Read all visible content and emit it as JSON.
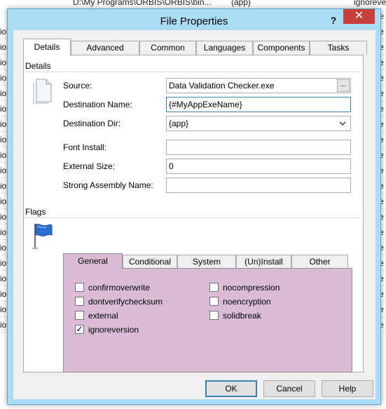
{
  "background": {
    "top_path": "D:\\My Programs\\ORBIS\\ORBIS\\bin...",
    "top_app": "{app}",
    "top_flag": "ignorevers",
    "left_fragments": [
      "io",
      "io",
      "io",
      "io",
      "io",
      "io",
      "io",
      "io",
      "io",
      "io",
      "io",
      "io",
      "io",
      "io",
      "io",
      "io",
      "io",
      "io",
      "io",
      "io"
    ],
    "right_fragments": [
      "ve",
      "ve",
      "ve",
      "ve",
      "ve",
      "ve",
      "ve",
      "ve",
      "ve",
      "ve",
      "ve",
      "ve",
      "ve",
      "ve",
      "ve",
      "ve",
      "ve",
      "ve",
      "ve",
      "ve",
      "ve"
    ]
  },
  "dialog": {
    "title": "File Properties",
    "help_glyph": "?",
    "close_glyph": "✕",
    "tabs": [
      {
        "label": "Details",
        "active": true
      },
      {
        "label": "Advanced",
        "active": false
      },
      {
        "label": "Common",
        "active": false
      },
      {
        "label": "Languages",
        "active": false
      },
      {
        "label": "Components",
        "active": false
      },
      {
        "label": "Tasks",
        "active": false
      }
    ],
    "details": {
      "section_label": "Details",
      "icon": "document-icon",
      "source_label": "Source:",
      "source_value": "Data Validation Checker.exe",
      "browse_label": "...",
      "dest_name_label": "Destination Name:",
      "dest_name_value": "{#MyAppExeName}",
      "dest_dir_label": "Destination Dir:",
      "dest_dir_value": "{app}",
      "font_install_label": "Font Install:",
      "font_install_value": "",
      "external_size_label": "External Size:",
      "external_size_value": "0",
      "strong_assembly_label": "Strong Assembly Name:",
      "strong_assembly_value": ""
    },
    "flags": {
      "section_label": "Flags",
      "icon": "flag-icon",
      "panel_color": "#dabcd6",
      "tabs": [
        {
          "label": "General",
          "active": true
        },
        {
          "label": "Conditional",
          "active": false
        },
        {
          "label": "System",
          "active": false
        },
        {
          "label": "(Un)Install",
          "active": false
        },
        {
          "label": "Other",
          "active": false
        }
      ],
      "left_checkboxes": [
        {
          "label": "confirmoverwrite",
          "checked": false
        },
        {
          "label": "dontverifychecksum",
          "checked": false
        },
        {
          "label": "external",
          "checked": false
        },
        {
          "label": "ignoreversion",
          "checked": true
        }
      ],
      "right_checkboxes": [
        {
          "label": "nocompression",
          "checked": false
        },
        {
          "label": "noencryption",
          "checked": false
        },
        {
          "label": "solidbreak",
          "checked": false
        }
      ]
    },
    "buttons": {
      "ok": "OK",
      "cancel": "Cancel",
      "help": "Help"
    },
    "colors": {
      "frame": "#aadcf3",
      "close": "#c7403a",
      "accent": "#3c7fb1"
    }
  }
}
